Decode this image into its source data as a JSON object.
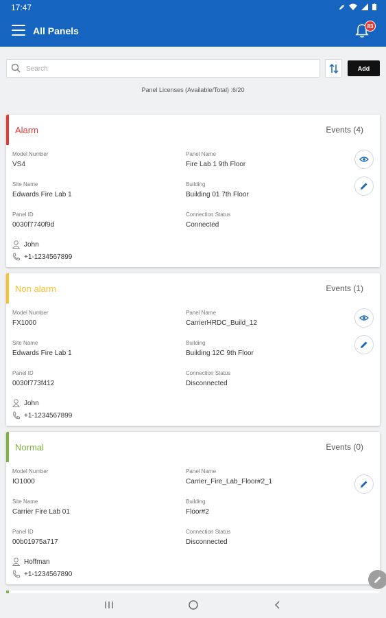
{
  "statusbar": {
    "time": "17:47"
  },
  "appbar": {
    "title": "All Panels",
    "notification_count": "83"
  },
  "search": {
    "placeholder": "Search"
  },
  "toolbar": {
    "add_label": "Add"
  },
  "licenses": "Panel Licenses (Available/Total) :6/20",
  "labels": {
    "model_number": "Model Number",
    "panel_name": "Panel Name",
    "site_name": "Site Name",
    "building": "Building",
    "panel_id": "Panel ID",
    "connection_status": "Connection Status"
  },
  "colors": {
    "primary": "#1565c0",
    "alarm": "#e53935",
    "non_alarm": "#fbc02d",
    "normal": "#7cb342"
  },
  "panels": [
    {
      "status": "Alarm",
      "events": "Events (4)",
      "model_number": "VS4",
      "panel_name": "Fire Lab 1 9th Floor",
      "site_name": "Edwards Fire Lab 1",
      "building": "Building 01 7th Floor",
      "panel_id": "0030f7740f9d",
      "connection_status": "Connected",
      "contact_name": "John",
      "contact_phone": "+1-1234567899"
    },
    {
      "status": "Non alarm",
      "events": "Events (1)",
      "model_number": "FX1000",
      "panel_name": "CarrierHRDC_Build_12",
      "site_name": "Edwards Fire Lab 1",
      "building": "Building 12C 9th Floor",
      "panel_id": "0030f773f412",
      "connection_status": "Disconnected",
      "contact_name": "John",
      "contact_phone": "+1-1234567899"
    },
    {
      "status": "Normal",
      "events": "Events (0)",
      "model_number": "IO1000",
      "panel_name": "Carrier_Fire_Lab_Floor#2_1",
      "site_name": "Carrier Fire Lab 01",
      "building": "Floor#2",
      "panel_id": "00b01975a717",
      "connection_status": "Disconnected",
      "contact_name": "Hoffman",
      "contact_phone": "+1-1234567890"
    }
  ]
}
